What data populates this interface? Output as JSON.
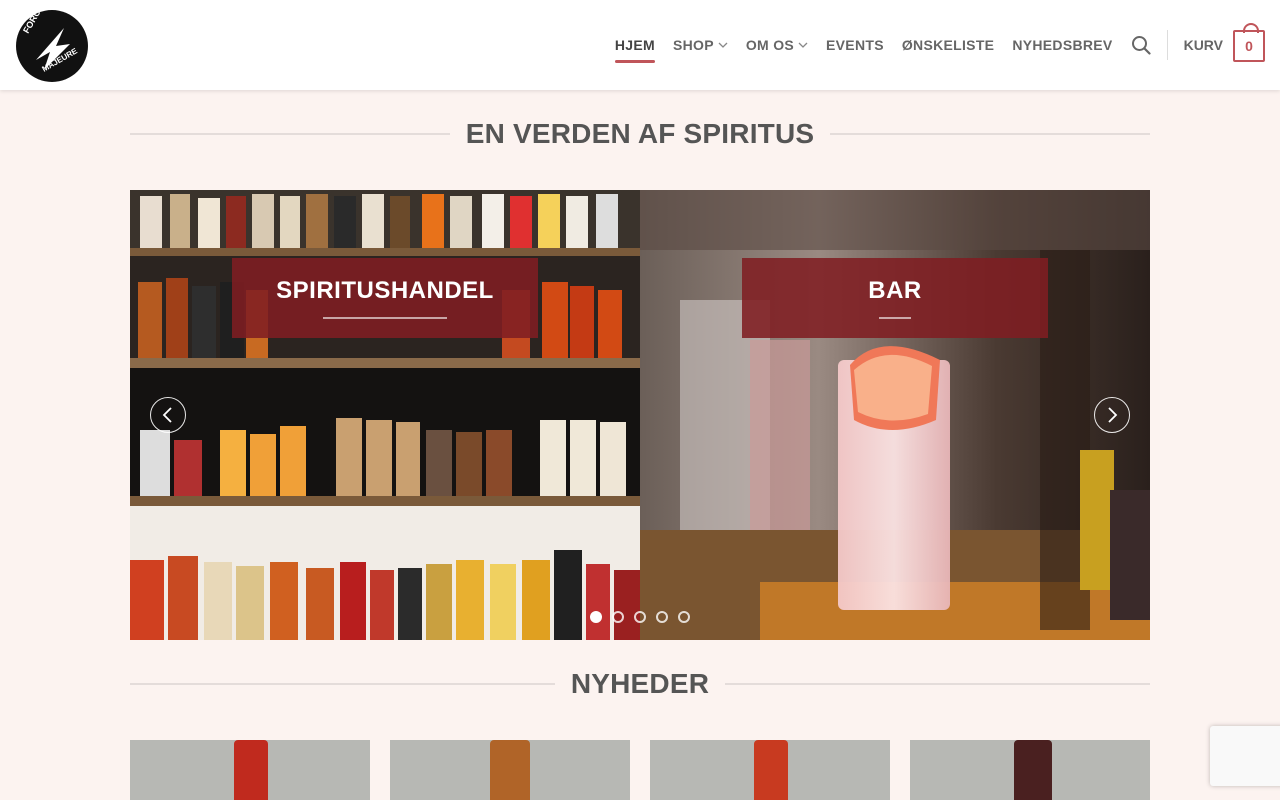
{
  "header": {
    "logo_text": "FORCE MAJEURE",
    "nav": [
      {
        "label": "HJEM",
        "active": true,
        "has_dropdown": false
      },
      {
        "label": "SHOP",
        "active": false,
        "has_dropdown": true
      },
      {
        "label": "OM OS",
        "active": false,
        "has_dropdown": true
      },
      {
        "label": "EVENTS",
        "active": false,
        "has_dropdown": false
      },
      {
        "label": "ØNSKELISTE",
        "active": false,
        "has_dropdown": false
      },
      {
        "label": "NYHEDSBREV",
        "active": false,
        "has_dropdown": false
      }
    ],
    "cart_label": "KURV",
    "cart_count": "0"
  },
  "hero": {
    "title": "EN VERDEN AF SPIRITUS",
    "slides": [
      {
        "label": "SPIRITUSHANDEL"
      },
      {
        "label": "BAR"
      }
    ],
    "dot_count": 5,
    "active_dot": 0
  },
  "news": {
    "title": "NYHEDER"
  },
  "colors": {
    "accent": "#c0555a",
    "slide_label_bg": "#801e22",
    "page_bg": "#fcf3f0"
  }
}
